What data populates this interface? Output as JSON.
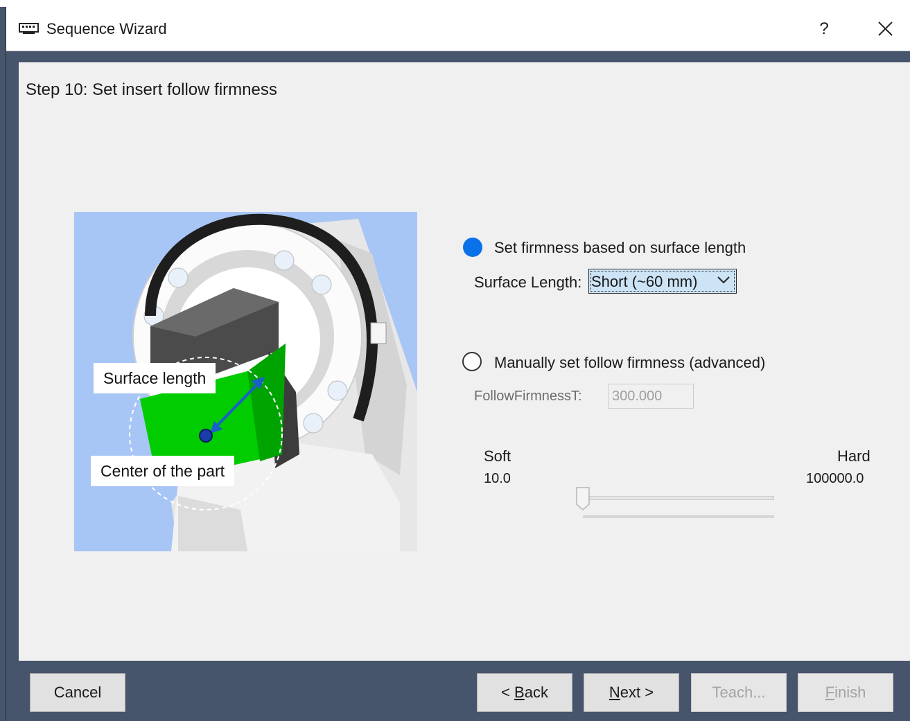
{
  "window": {
    "title": "Sequence Wizard",
    "help_label": "?",
    "icon": "wizard-app-icon"
  },
  "step": {
    "title": "Step 10: Set insert follow firmness"
  },
  "illustration": {
    "callout_surface": "Surface length",
    "callout_center": "Center of the part"
  },
  "options": {
    "surface_radio_label": "Set firmness based on surface length",
    "surface_length_label": "Surface Length:",
    "surface_length_value": "Short (~60 mm)",
    "manual_radio_label": "Manually set follow firmness (advanced)",
    "follow_firmness_label": "FollowFirmnessT:",
    "follow_firmness_value": "300.000",
    "selected": "surface"
  },
  "slider": {
    "soft_label": "Soft",
    "soft_value": "10.0",
    "hard_label": "Hard",
    "hard_value": "100000.0",
    "position": 0
  },
  "footer": {
    "cancel": "Cancel",
    "back_prefix": "< ",
    "back_mnemonic": "B",
    "back_rest": "ack",
    "next_mnemonic": "N",
    "next_rest": "ext >",
    "teach": "Teach...",
    "finish_mnemonic": "F",
    "finish_rest": "inish"
  },
  "colors": {
    "accent": "#0a72e8",
    "frame": "#46546c",
    "panel": "#f0f0f0",
    "part_green": "#00cc00"
  }
}
